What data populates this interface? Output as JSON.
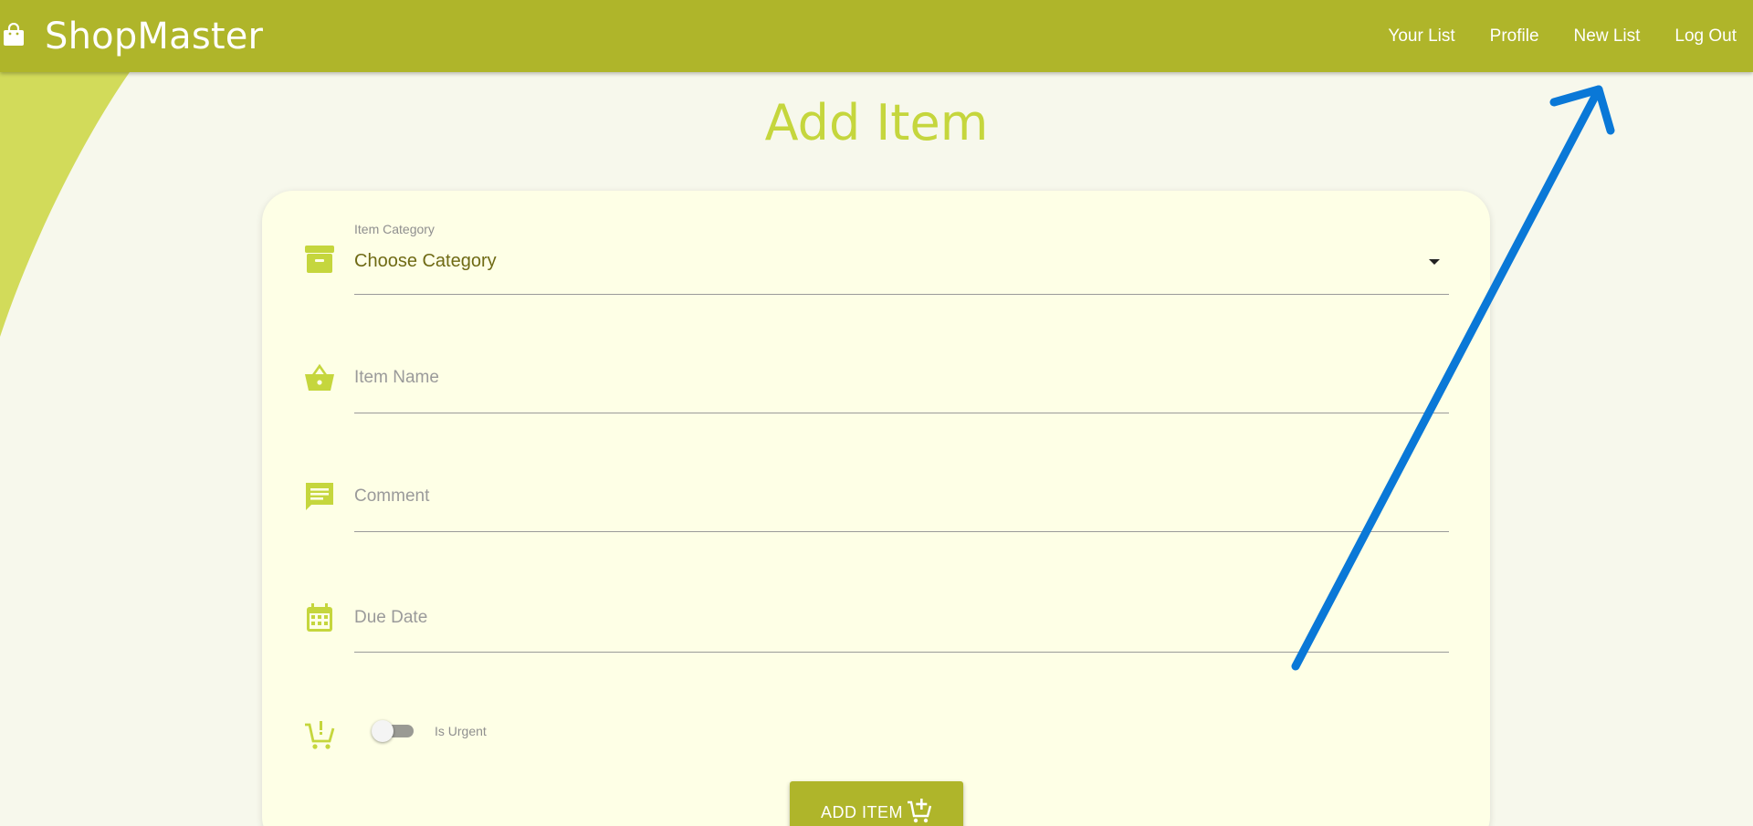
{
  "app": {
    "title": "ShopMaster",
    "brand_icon": "shopping-bag-icon",
    "accent_color": "#afb52a",
    "light_accent_color": "#c5d63d"
  },
  "nav": {
    "links": [
      {
        "label": "Your List"
      },
      {
        "label": "Profile"
      },
      {
        "label": "New List"
      },
      {
        "label": "Log Out"
      }
    ]
  },
  "page": {
    "title": "Add Item"
  },
  "form": {
    "category": {
      "label": "Item Category",
      "value": "Choose Category",
      "icon": "archive-box-icon"
    },
    "item_name": {
      "placeholder": "Item Name",
      "icon": "basket-icon"
    },
    "comment": {
      "placeholder": "Comment",
      "icon": "comment-icon"
    },
    "due_date": {
      "placeholder": "Due Date",
      "icon": "calendar-icon"
    },
    "urgent": {
      "label": "Is Urgent",
      "checked": false,
      "icon": "cart-urgent-icon"
    },
    "submit": {
      "label": "ADD ITEM",
      "icon": "add-to-cart-icon"
    }
  },
  "annotation": {
    "type": "arrow",
    "color": "#0a78d7"
  }
}
